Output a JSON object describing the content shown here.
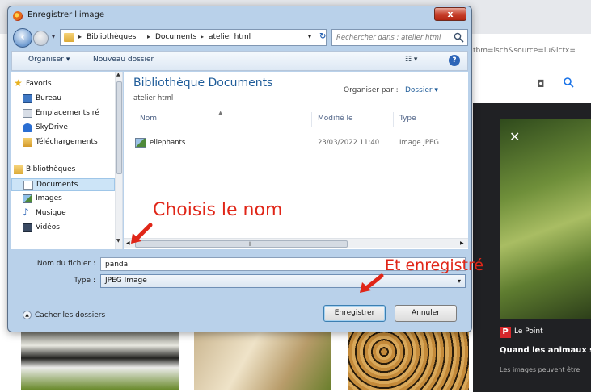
{
  "browser": {
    "url_fragment": "tbm=isch&source=iu&ictx=",
    "panel": {
      "source_name": "Le Point",
      "source_logo": "P",
      "title": "Quand les animaux s",
      "note": "Les images peuvent être"
    }
  },
  "dialog": {
    "title": "Enregistrer l'image",
    "close_label": "x",
    "breadcrumb": [
      "Bibliothèques",
      "Documents",
      "atelier html"
    ],
    "search_placeholder": "Rechercher dans : atelier html",
    "toolbar": {
      "organize": "Organiser ▾",
      "new_folder": "Nouveau dossier"
    },
    "nav": {
      "favorites_header": "Favoris",
      "favorites": [
        "Bureau",
        "Emplacements ré",
        "SkyDrive",
        "Téléchargements"
      ],
      "libraries_header": "Bibliothèques",
      "libraries": [
        "Documents",
        "Images",
        "Musique",
        "Vidéos"
      ]
    },
    "library": {
      "title": "Bibliothèque Documents",
      "subtitle": "atelier html",
      "arrange_label": "Organiser par :",
      "arrange_value": "Dossier ▾"
    },
    "columns": {
      "name": "Nom",
      "modified": "Modifié le",
      "type": "Type"
    },
    "files": [
      {
        "name": "ellephants",
        "modified": "23/03/2022 11:40",
        "type": "Image JPEG"
      }
    ],
    "form": {
      "filename_label": "Nom du fichier :",
      "filename_value": "panda",
      "type_label": "Type :",
      "type_value": "JPEG Image"
    },
    "hide_folders": "Cacher les dossiers",
    "save_button": "Enregistrer",
    "cancel_button": "Annuler"
  },
  "annotations": {
    "choose_name": "Choisis le nom",
    "and_save": "Et enregistré",
    "color": "#e02618"
  },
  "colors": {
    "dialog_frame": "#b9d1ea",
    "library_title": "#1f5c99",
    "close_button": "#c7412d"
  }
}
